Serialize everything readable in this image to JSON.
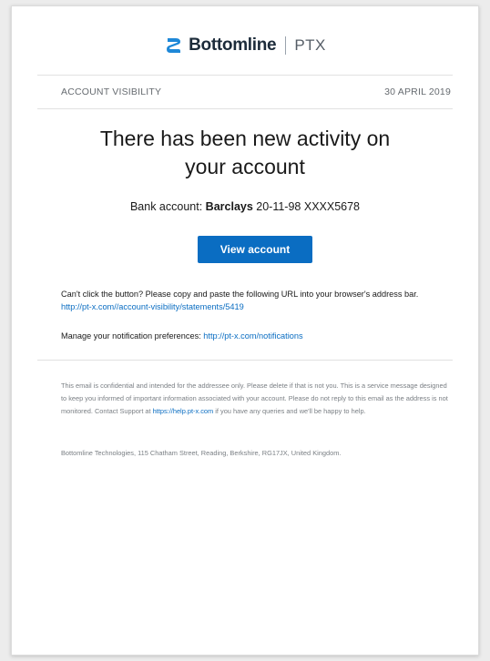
{
  "brand": {
    "name": "Bottomline",
    "product": "PTX",
    "accent_color": "#1e88d8"
  },
  "meta": {
    "section": "ACCOUNT VISIBILITY",
    "date": "30 APRIL 2019"
  },
  "headline": {
    "line1": "There has been new activity on",
    "line2": "your account"
  },
  "bank": {
    "label": "Bank account: ",
    "bank_name": "Barclays",
    "account": " 20-11-98 XXXX5678"
  },
  "cta": {
    "label": "View account",
    "color": "#0a6dc2"
  },
  "help": {
    "text": "Can't click the button? Please copy and paste the following URL into your browser's address bar.",
    "url": "http://pt-x.com//account-visibility/statements/5419"
  },
  "notifications": {
    "text": "Manage your notification preferences: ",
    "url": "http://pt-x.com/notifications"
  },
  "footer": {
    "text_before": "This email is confidential and intended for the addressee only. Please delete if that is not you. This is a service message designed to keep you informed of important information associated with your account. Please do not reply to this email as the address is not monitored. Contact Support at ",
    "support_url": "https://help.pt-x.com",
    "text_after": " if you have any queries and we'll be happy to help.",
    "address": "Bottomline Technologies, 115 Chatham Street, Reading, Berkshire, RG17JX, United Kingdom."
  }
}
